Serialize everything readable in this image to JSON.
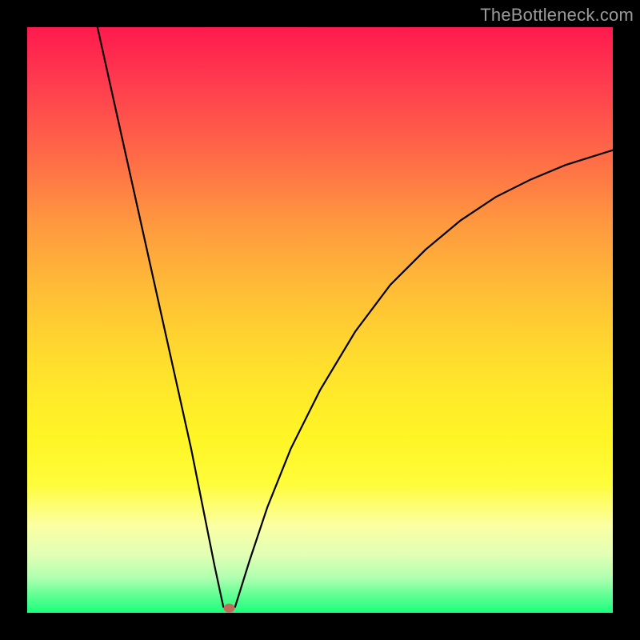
{
  "watermark": "TheBottleneck.com",
  "chart_data": {
    "type": "line",
    "title": "",
    "xlabel": "",
    "ylabel": "",
    "xlim": [
      0,
      100
    ],
    "ylim": [
      0,
      100
    ],
    "background": "rainbow-gradient",
    "marker": {
      "x": 34.5,
      "y": 0.8,
      "color": "#c36b5a"
    },
    "series": [
      {
        "name": "left-branch",
        "x": [
          12,
          14,
          16,
          18,
          20,
          22,
          24,
          26,
          28,
          30,
          32,
          33.5
        ],
        "values": [
          100,
          91,
          82,
          73,
          64,
          55,
          46,
          37,
          28,
          18,
          8,
          1
        ]
      },
      {
        "name": "right-branch",
        "x": [
          35.5,
          38,
          41,
          45,
          50,
          56,
          62,
          68,
          74,
          80,
          86,
          92,
          100
        ],
        "values": [
          1,
          9,
          18,
          28,
          38,
          48,
          56,
          62,
          67,
          71,
          74,
          76.5,
          79
        ]
      }
    ]
  }
}
